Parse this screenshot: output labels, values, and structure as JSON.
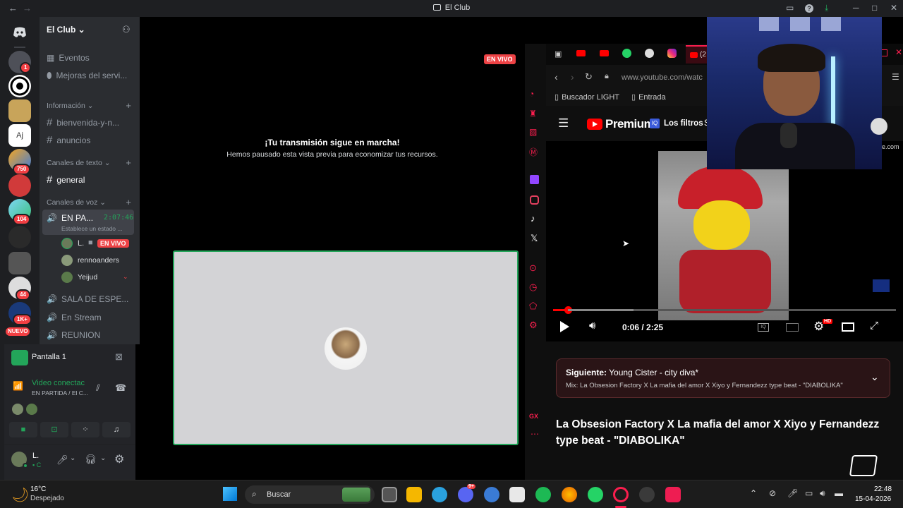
{
  "window": {
    "title": "El Club"
  },
  "server": {
    "name": "El Club"
  },
  "server_badges": {
    "s1": "1",
    "s5": "750",
    "s7": "104",
    "s10": "44",
    "s11": "1K+",
    "new": "NUEVO"
  },
  "channels": {
    "events": "Eventos",
    "boosts": "Mejoras del servi...",
    "cat_info": "Información",
    "welcome": "bienvenida-y-n...",
    "announcements": "anuncios",
    "cat_text": "Canales de texto",
    "general": "general",
    "cat_voice": "Canales de voz",
    "voice_channel": "EN PA...",
    "voice_timer": "2:07:46",
    "voice_status": "Establece un estado ...",
    "users": [
      {
        "name": "L.",
        "live": "EN VIVO"
      },
      {
        "name": "rennoanders"
      },
      {
        "name": "Yeijud"
      }
    ],
    "waiting_room": "SALA DE ESPE...",
    "en_stream": "En Stream",
    "reunion": "REUNION"
  },
  "voice_panel": {
    "screen": "Pantalla 1",
    "status": "Video conectac",
    "location": "EN PARTIDA / El C..."
  },
  "user_panel": {
    "name": "L.",
    "sub": "C"
  },
  "stage": {
    "live_badge": "EN VIVO",
    "heading": "¡Tu transmisión sigue en marcha!",
    "subtext": "Hemos pausado esta vista previa para economizar tus recursos."
  },
  "browser": {
    "url": "www.youtube.com/watc",
    "bookmarks": [
      "Buscador LIGHT",
      "Entrada"
    ],
    "tab_count": "(2"
  },
  "youtube": {
    "logo": "Premium",
    "filters": "Los filtros",
    "filters_cont": "S",
    "side_text": "e.com",
    "time": "0:06 / 2:25",
    "progress": 0.044,
    "hd": "HD",
    "next_label": "Siguiente:",
    "next_title": "Young Cister - city diva*",
    "mix": "Mix: La Obsesion Factory X La mafia del amor X Xiyo y Fernandezz type beat - \"DIABOLIKA\"",
    "video_title": "La Obsesion Factory X La mafia del amor X Xiyo y Fernandezz type beat - \"DIABOLIKA\"",
    "side_gx": "GX"
  },
  "taskbar": {
    "temp": "16°C",
    "weather": "Despejado",
    "search": "Buscar",
    "time": "22:48",
    "date": "15-04-2026",
    "discord_badge": "9+"
  },
  "colors": {
    "discord_bg": "#2b2d31",
    "discord_dark": "#1e1f22",
    "live_red": "#ed4245",
    "green": "#23a55a",
    "yt_red": "#ff0000"
  }
}
